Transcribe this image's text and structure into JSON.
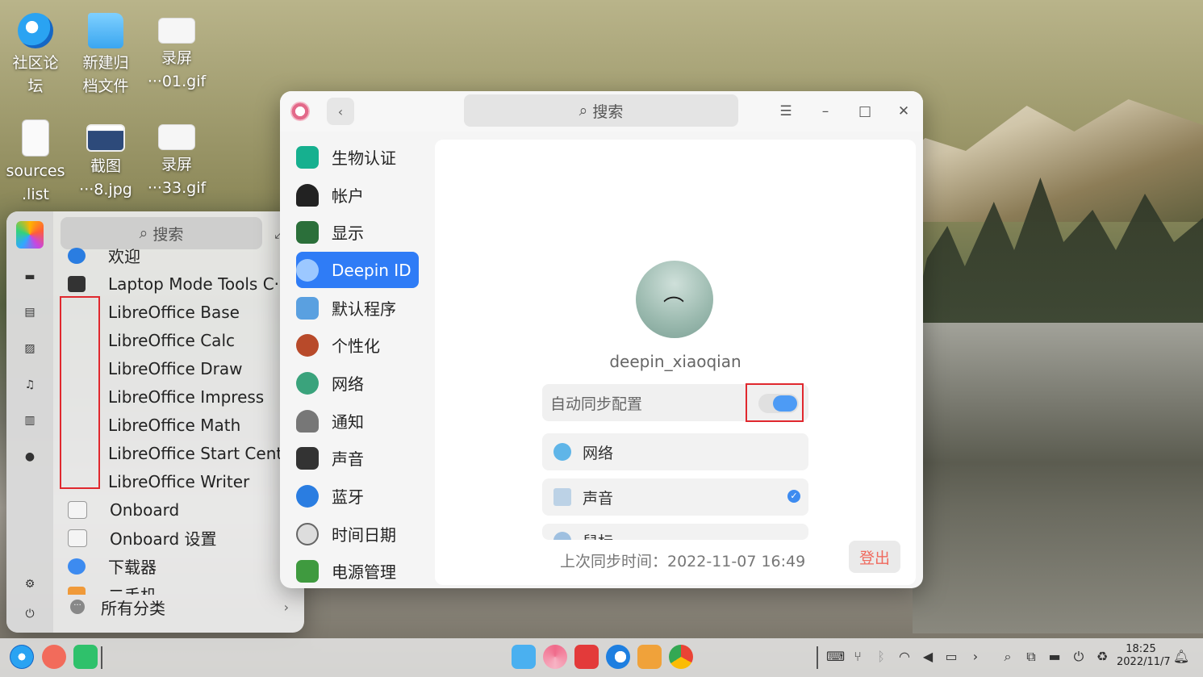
{
  "desktop": {
    "icons": [
      {
        "label_l1": "社区论",
        "label_l2": "坛",
        "icon": "deepin-community-icon"
      },
      {
        "label_l1": "新建归",
        "label_l2": "档文件",
        "icon": "folder-icon"
      },
      {
        "label_l1": "录屏",
        "label_l2": "···01.gif",
        "icon": "gif-file-icon"
      },
      {
        "label_l1": "sources",
        "label_l2": ".list",
        "icon": "text-file-icon"
      },
      {
        "label_l1": "截图",
        "label_l2": "···8.jpg",
        "icon": "image-file-icon"
      },
      {
        "label_l1": "录屏",
        "label_l2": "···33.gif",
        "icon": "gif-file-icon"
      }
    ]
  },
  "launcher": {
    "search_placeholder": "搜索",
    "apps": [
      {
        "name": "欢迎"
      },
      {
        "name": "Laptop Mode Tools C···"
      },
      {
        "name": "LibreOffice Base"
      },
      {
        "name": "LibreOffice Calc"
      },
      {
        "name": "LibreOffice Draw"
      },
      {
        "name": "LibreOffice Impress"
      },
      {
        "name": "LibreOffice Math"
      },
      {
        "name": "LibreOffice Start Center"
      },
      {
        "name": "LibreOffice Writer"
      },
      {
        "name": "Onboard"
      },
      {
        "name": "Onboard 设置"
      },
      {
        "name": "下载器"
      },
      {
        "name": "二手机"
      }
    ],
    "all_categories": "所有分类"
  },
  "settings": {
    "search_placeholder": "搜索",
    "nav": [
      {
        "label": "生物认证",
        "color": "#16b08f"
      },
      {
        "label": "帐户",
        "color": "#222222"
      },
      {
        "label": "显示",
        "color": "#2b6f3a"
      },
      {
        "label": "Deepin ID",
        "color": "#4d9bf5"
      },
      {
        "label": "默认程序",
        "color": "#5aa0e0"
      },
      {
        "label": "个性化",
        "color": "#b84a2a"
      },
      {
        "label": "网络",
        "color": "#3aa37c"
      },
      {
        "label": "通知",
        "color": "#555555"
      },
      {
        "label": "声音",
        "color": "#333333"
      },
      {
        "label": "蓝牙",
        "color": "#2a7de1"
      },
      {
        "label": "时间日期",
        "color": "#666666"
      },
      {
        "label": "电源管理",
        "color": "#3f9a3f"
      }
    ],
    "account": {
      "username": "deepin_xiaoqian",
      "auto_sync_label": "自动同步配置",
      "auto_sync_on": true,
      "items": [
        {
          "label": "网络",
          "checked": false
        },
        {
          "label": "声音",
          "checked": true
        },
        {
          "label": "鼠标",
          "checked": true
        }
      ],
      "last_sync": "上次同步时间：2022-11-07 16:49",
      "logout": "登出"
    }
  },
  "taskbar": {
    "time": "18:25",
    "date": "2022/11/7"
  },
  "colors": {
    "accent": "#2f7cf6",
    "highlight_box": "#e0282e",
    "logout_text": "#f06a5e"
  }
}
